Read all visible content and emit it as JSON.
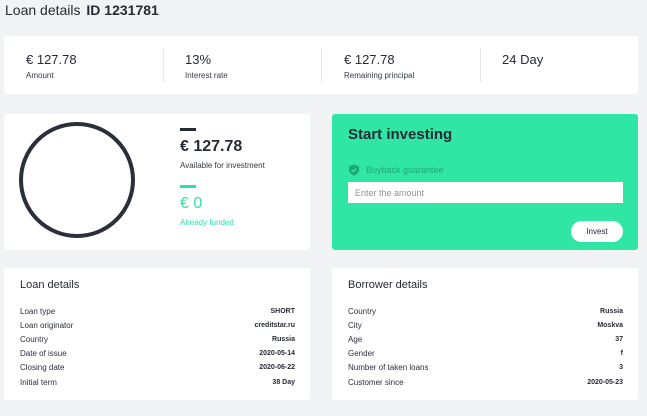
{
  "header": {
    "title": "Loan details",
    "id_label": "ID 1231781"
  },
  "stats": [
    {
      "value": "€ 127.78",
      "label": "Amount"
    },
    {
      "value": "13%",
      "label": "Interest rate"
    },
    {
      "value": "€ 127.78",
      "label": "Remaining principal"
    },
    {
      "value": "24 Day",
      "label": ""
    }
  ],
  "summary": {
    "available_value": "€ 127.78",
    "available_label": "Available for investment",
    "funded_value": "€ 0",
    "funded_label": "Already funded",
    "funded_fraction": 0
  },
  "invest": {
    "title": "Start investing",
    "buyback_label": "Buyback guarantee",
    "amount_placeholder": "Enter the amount",
    "button_label": "Invest"
  },
  "loan_details": {
    "title": "Loan details",
    "rows": [
      {
        "label": "Loan type",
        "value": "SHORT"
      },
      {
        "label": "Loan originator",
        "value": "creditstar.ru"
      },
      {
        "label": "Country",
        "value": "Russia"
      },
      {
        "label": "Date of issue",
        "value": "2020-05-14"
      },
      {
        "label": "Closing date",
        "value": "2020-06-22"
      },
      {
        "label": "Initial term",
        "value": "38 Day"
      }
    ]
  },
  "borrower_details": {
    "title": "Borrower details",
    "rows": [
      {
        "label": "Country",
        "value": "Russia"
      },
      {
        "label": "City",
        "value": "Moskva"
      },
      {
        "label": "Age",
        "value": "37"
      },
      {
        "label": "Gender",
        "value": "f"
      },
      {
        "label": "Number of taken loans",
        "value": "3"
      },
      {
        "label": "Customer since",
        "value": "2020-05-23"
      }
    ]
  },
  "colors": {
    "accent": "#30e6a4",
    "text": "#262b33",
    "background": "#f2f3f4"
  }
}
